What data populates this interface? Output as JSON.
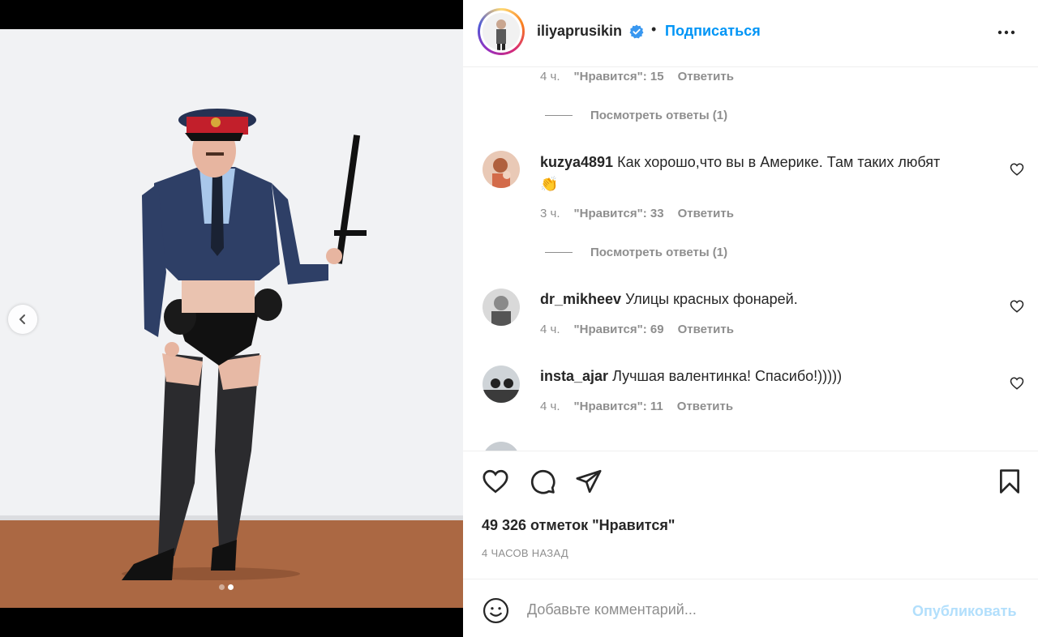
{
  "post": {
    "username": "iliyaprusikin",
    "follow_label": "Подписаться",
    "dot_separator": "•",
    "likes_text": "49 326 отметок \"Нравится\"",
    "time_ago": "4 ЧАСОВ НАЗАД",
    "carousel": {
      "total": 2,
      "current": 2
    }
  },
  "comments": [
    {
      "meta": {
        "time": "4 ч.",
        "likes": "\"Нравится\": 15",
        "reply": "Ответить"
      },
      "view_replies": "Посмотреть ответы (1)"
    },
    {
      "username": "kuzya4891",
      "text": "Как хорошо,что вы в Америке. Там таких любят",
      "emoji": "👏",
      "meta": {
        "time": "3 ч.",
        "likes": "\"Нравится\": 33",
        "reply": "Ответить"
      },
      "view_replies": "Посмотреть ответы (1)"
    },
    {
      "username": "dr_mikheev",
      "text": "Улицы красных фонарей.",
      "meta": {
        "time": "4 ч.",
        "likes": "\"Нравится\": 69",
        "reply": "Ответить"
      }
    },
    {
      "username": "insta_ajar",
      "text": "Лучшая валентинка! Спасибо!)))))",
      "meta": {
        "time": "4 ч.",
        "likes": "\"Нравится\": 11",
        "reply": "Ответить"
      }
    }
  ],
  "comment_box": {
    "placeholder": "Добавьте комментарий...",
    "publish_label": "Опубликовать"
  },
  "colors": {
    "accent": "#0095f6",
    "publish_disabled": "#b2dffc",
    "muted": "#8e8e8e",
    "text": "#262626"
  },
  "icons": [
    "chevron-left-icon",
    "verified-badge-icon",
    "more-icon",
    "heart-icon",
    "comment-icon",
    "share-icon",
    "bookmark-icon",
    "emoji-icon"
  ]
}
